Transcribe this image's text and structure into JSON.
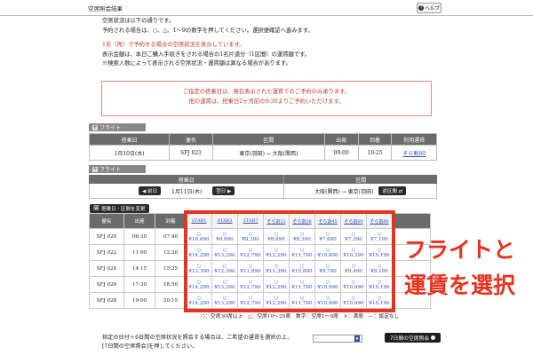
{
  "header": {
    "title": "空席照会結果",
    "help_label": "ヘルプ"
  },
  "intro": {
    "line1": "空席状況は以下の通りです。",
    "line2": "予約される場合は、○、△、1〜9の数字を押してください。選択便確認へ進みます。",
    "line3_red": "1名（席）で予約する場合の空席状況を表示しています。",
    "line4": "表示金額は、本日ご購入手続きをされる場合の1名片道分（1区間）の運賃額です。",
    "line5": "※検索人数によって表示される空席状況・運賃額は異なる場合があります。"
  },
  "notice": {
    "line1": "ご指定の搭乗日は、現在表示された運賃でのご予約のみ承ります。",
    "line2": "他の運賃は、搭乗日2ヶ月前の9:30よりご予約いただけます。"
  },
  "flight1": {
    "section_label": "フライト",
    "headers": [
      "搭乗日",
      "便名",
      "区間",
      "出発",
      "到着",
      "利用運賃"
    ],
    "row": [
      "1月10日(水)",
      "SFJ 021",
      "東京(羽田) → 大阪(関西)",
      "09:00",
      "10:25",
      "そら割80"
    ]
  },
  "flight2": {
    "section_label": "フライト",
    "date_header": "搭乗日",
    "route_header": "区間",
    "prev_label": "◀ 前日",
    "date": "1月11日(木)",
    "next_label": "翌日 ▶",
    "route": "大阪(関西) → 東京(羽田)",
    "reverse_label": "逆区間 ⇄",
    "date_change_label": "搭乗日・区間を変更"
  },
  "grid": {
    "headers": [
      "便名",
      "出発",
      "到着"
    ],
    "fares": [
      "STAR1",
      "STAR3",
      "STAR7",
      "そら割21",
      "そら割28",
      "そら割45",
      "そら割60",
      "そら割80"
    ],
    "rows": [
      {
        "flight": "SFJ 020",
        "dep": "06:30",
        "arr": "07:40",
        "prices": [
          "¥10,690",
          "¥9,690",
          "¥9,390",
          "¥8,690",
          "¥8,390",
          "¥7,690",
          "¥7,390",
          "¥7,190"
        ]
      },
      {
        "flight": "SFJ 022",
        "dep": "11:00",
        "arr": "12:20",
        "prices": [
          "¥14,290",
          "¥13,290",
          "¥12,790",
          "¥12,290",
          "¥11,790",
          "¥10,890",
          "¥10,390",
          "¥10,190"
        ]
      },
      {
        "flight": "SFJ 024",
        "dep": "14:15",
        "arr": "15:25",
        "prices": [
          "¥13,390",
          "¥12,390",
          "¥11,890",
          "¥11,390",
          "¥10,890",
          "¥9,790",
          "¥9,490",
          "¥9,190"
        ]
      },
      {
        "flight": "SFJ 026",
        "dep": "17:30",
        "arr": "18:50",
        "prices": [
          "¥14,290",
          "¥13,290",
          "¥12,790",
          "¥12,290",
          "¥11,790",
          "¥10,990",
          "¥10,690",
          "¥10,190"
        ]
      },
      {
        "flight": "SFJ 028",
        "dep": "19:00",
        "arr": "20:15",
        "prices": [
          "¥14,290",
          "¥13,290",
          "¥12,790",
          "¥12,290",
          "¥11,790",
          "¥10,990",
          "¥10,690",
          "¥10,190"
        ]
      }
    ],
    "symbol": "○"
  },
  "legend": "○：空席30席以上　△：空席10〜29席　数字：空席1〜9席　×：満席　—：設定なし",
  "callout": {
    "line1": "フライトと",
    "line2": "運賃を選択"
  },
  "bottom": {
    "text": "指定の日付＋6日間の空席状況を照会する場合は、ご希望の運賃を選択の上、[7日間の空席照会]を押してください。",
    "select_value": "-",
    "week_button": "7日間の空席照会"
  }
}
